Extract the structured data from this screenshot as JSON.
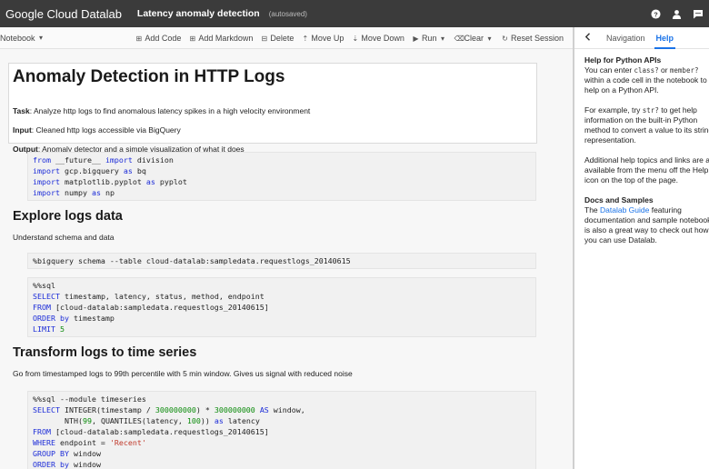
{
  "topbar": {
    "logo": "Google Cloud Datalab",
    "notebook_title": "Latency anomaly detection",
    "status": "(autosaved)",
    "icons": [
      "help-icon",
      "account-icon",
      "feedback-icon"
    ]
  },
  "toolbar": {
    "notebook_menu": "Notebook",
    "add_code": "Add Code",
    "add_markdown": "Add Markdown",
    "delete": "Delete",
    "move_up": "Move Up",
    "move_down": "Move Down",
    "run": "Run",
    "clear": "Clear",
    "reset_session": "Reset Session"
  },
  "cells": {
    "title": "Anomaly Detection in HTTP Logs",
    "task_label": "Task",
    "task_text": ": Analyze http logs to find anomalous latency spikes in a high velocity environment",
    "input_label": "Input",
    "input_text": ": Cleaned http logs accessible via BigQuery",
    "output_label": "Output",
    "output_text": ": Anomaly detector and a simple visualization of what it does",
    "code1": [
      "from __future__ import division",
      "import gcp.bigquery as bq",
      "import matplotlib.pyplot as pyplot",
      "import numpy as np"
    ],
    "explore_heading": "Explore logs data",
    "explore_text": "Understand schema and data",
    "code2": "%bigquery schema --table cloud-datalab:sampledata.requestlogs_20140615",
    "code3": [
      "%%sql",
      "SELECT timestamp, latency, status, method, endpoint",
      "FROM [cloud-datalab:sampledata.requestlogs_20140615]",
      "ORDER by timestamp",
      "LIMIT 5"
    ],
    "transform_heading": "Transform logs to time series",
    "transform_text": "Go from timestamped logs to 99th percentile with 5 min window. Gives us signal with reduced noise",
    "code4": [
      "%%sql --module timeseries",
      "SELECT INTEGER(timestamp / 300000000) * 300000000 AS window,",
      "       NTH(99, QUANTILES(latency, 100)) as latency",
      "FROM [cloud-datalab:sampledata.requestlogs_20140615]",
      "WHERE endpoint = 'Recent'",
      "GROUP BY window",
      "ORDER by window"
    ]
  },
  "side_panel": {
    "tab_navigation": "Navigation",
    "tab_help": "Help",
    "help_heading": "Help for Python APIs",
    "help_l1": "You can enter ",
    "help_code1": "class?",
    "help_l1b": " or ",
    "help_code2": "member?",
    "help_l2": "within a code cell in the notebook to",
    "help_l3": "help on a Python API.",
    "ex_l1": "For example, try ",
    "ex_code": "str?",
    "ex_l1b": " to get help",
    "ex_l2": "information on the built-in Python",
    "ex_l3": "method to convert a value to its string",
    "ex_l4": "representation.",
    "add_l1": "Additional help topics and links are a",
    "add_l2": "available from the menu off the Help",
    "add_l3": "icon on the top of the page.",
    "docs_heading": "Docs and Samples",
    "docs_pre": "The ",
    "docs_link": "Datalab Guide",
    "docs_post": " featuring",
    "docs_l2": "documentation and sample notebooks",
    "docs_l3": "is also a great way to check out how",
    "docs_l4": "you can use Datalab."
  }
}
